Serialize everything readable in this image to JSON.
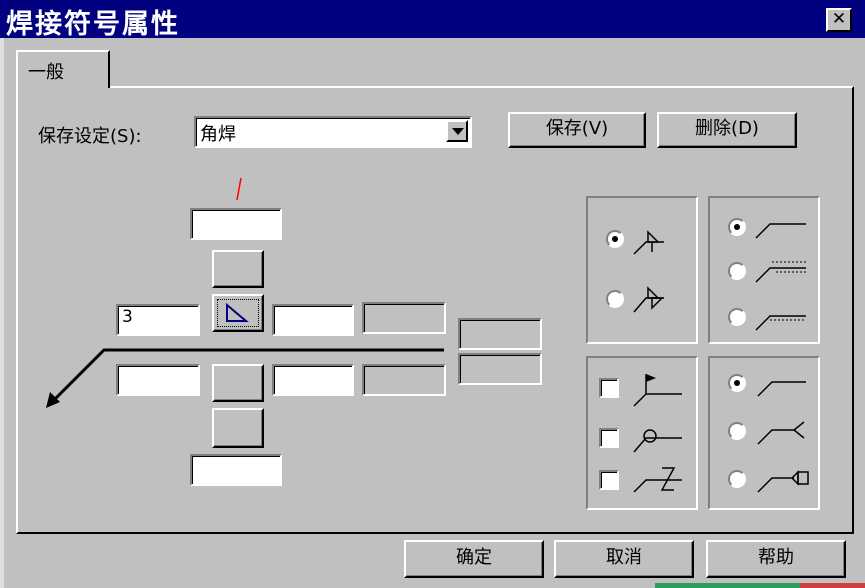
{
  "window": {
    "title": "焊接符号属性",
    "close_glyph": "✕"
  },
  "tabs": [
    {
      "label": "一般"
    }
  ],
  "save_settings": {
    "label": "保存设定(S):",
    "value": "角焊",
    "save_button": "保存(V)",
    "delete_button": "删除(D)"
  },
  "weld_fields": {
    "above_size": "3",
    "below_size": ""
  },
  "icons": {
    "triangle": "fillet-weld-triangle-icon",
    "arrow": "leader-arrow-icon"
  },
  "symbol_options": {
    "arrow_side": [
      {
        "checked": true
      },
      {
        "checked": false
      }
    ],
    "contour": [
      {
        "checked": true
      },
      {
        "checked": false
      },
      {
        "checked": false
      }
    ],
    "extras": [
      {
        "checked": false
      },
      {
        "checked": false
      },
      {
        "checked": false
      }
    ],
    "tail": [
      {
        "checked": true
      },
      {
        "checked": false
      },
      {
        "checked": false
      }
    ]
  },
  "dialog_buttons": {
    "ok": "确定",
    "cancel": "取消",
    "help": "帮助"
  },
  "colors": {
    "titlebar": "#000080",
    "face": "#c0c0c0",
    "triangle": "#000080",
    "tick": "#ff0000"
  }
}
